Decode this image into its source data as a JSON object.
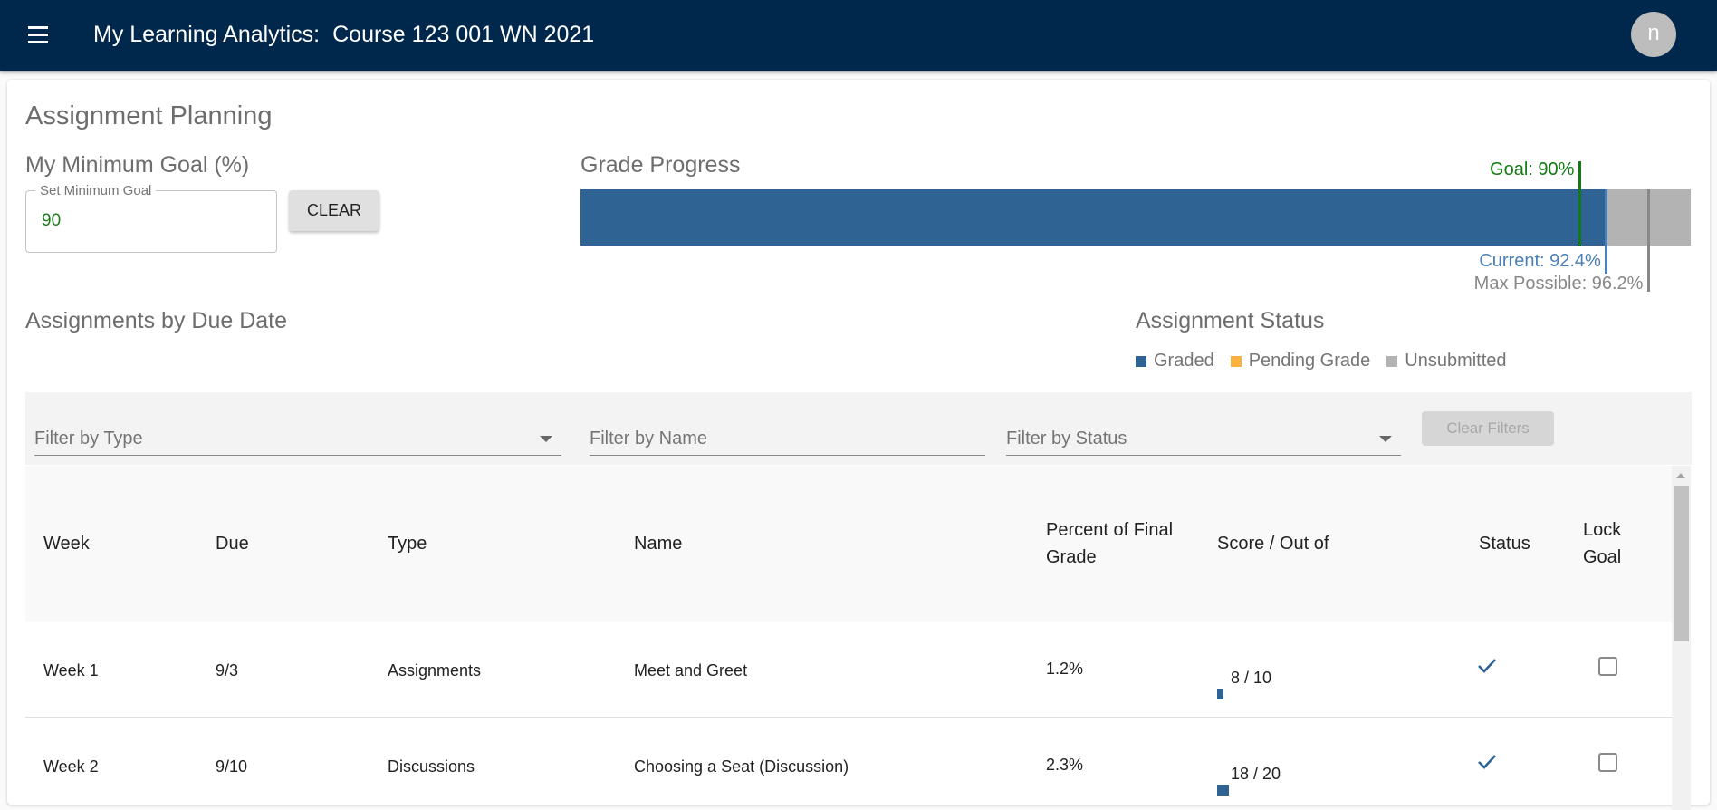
{
  "appbar": {
    "app_name": "My Learning Analytics:",
    "course": "Course 123 001 WN 2021",
    "avatar_initial": "n",
    "menu_icon": "menu-icon"
  },
  "page": {
    "title": "Assignment Planning"
  },
  "goal": {
    "heading": "My Minimum Goal (%)",
    "field_label": "Set Minimum Goal",
    "value": "90",
    "clear_label": "CLEAR"
  },
  "grade_progress": {
    "heading": "Grade Progress",
    "goal_percent": 90,
    "current_percent": 92.4,
    "max_possible_percent": 96.2,
    "goal_label": "Goal: 90%",
    "current_label": "Current: 92.4%",
    "max_label": "Max Possible: 96.2%",
    "colors": {
      "fill": "#2e6393",
      "remaining": "#b3b3b3",
      "goal": "#127a12",
      "current": "#4a80b8",
      "max": "#888888"
    }
  },
  "assignments": {
    "heading": "Assignments by Due Date"
  },
  "status_legend": {
    "heading": "Assignment Status",
    "items": [
      {
        "label": "Graded",
        "color": "#2e6393"
      },
      {
        "label": "Pending Grade",
        "color": "#fbb040"
      },
      {
        "label": "Unsubmitted",
        "color": "#b3b3b3"
      }
    ]
  },
  "filters": {
    "type_placeholder": "Filter by Type",
    "name_placeholder": "Filter by Name",
    "status_placeholder": "Filter by Status",
    "clear_label": "Clear Filters"
  },
  "table": {
    "headers": {
      "week": "Week",
      "due": "Due",
      "type": "Type",
      "name": "Name",
      "percent_line1": "Percent of Final",
      "percent_line2": "Grade",
      "score": "Score / Out of",
      "status": "Status",
      "lock_line1": "Lock",
      "lock_line2": "Goal"
    },
    "rows": [
      {
        "week": "Week 1",
        "due": "9/3",
        "type": "Assignments",
        "name": "Meet and Greet",
        "percent": "1.2%",
        "percent_value": 1.2,
        "score": "8 / 10",
        "status": "graded",
        "lock_goal": false
      },
      {
        "week": "Week 2",
        "due": "9/10",
        "type": "Discussions",
        "name": "Choosing a Seat (Discussion)",
        "percent": "2.3%",
        "percent_value": 2.3,
        "score": "18 / 20",
        "status": "graded",
        "lock_goal": false
      }
    ]
  }
}
